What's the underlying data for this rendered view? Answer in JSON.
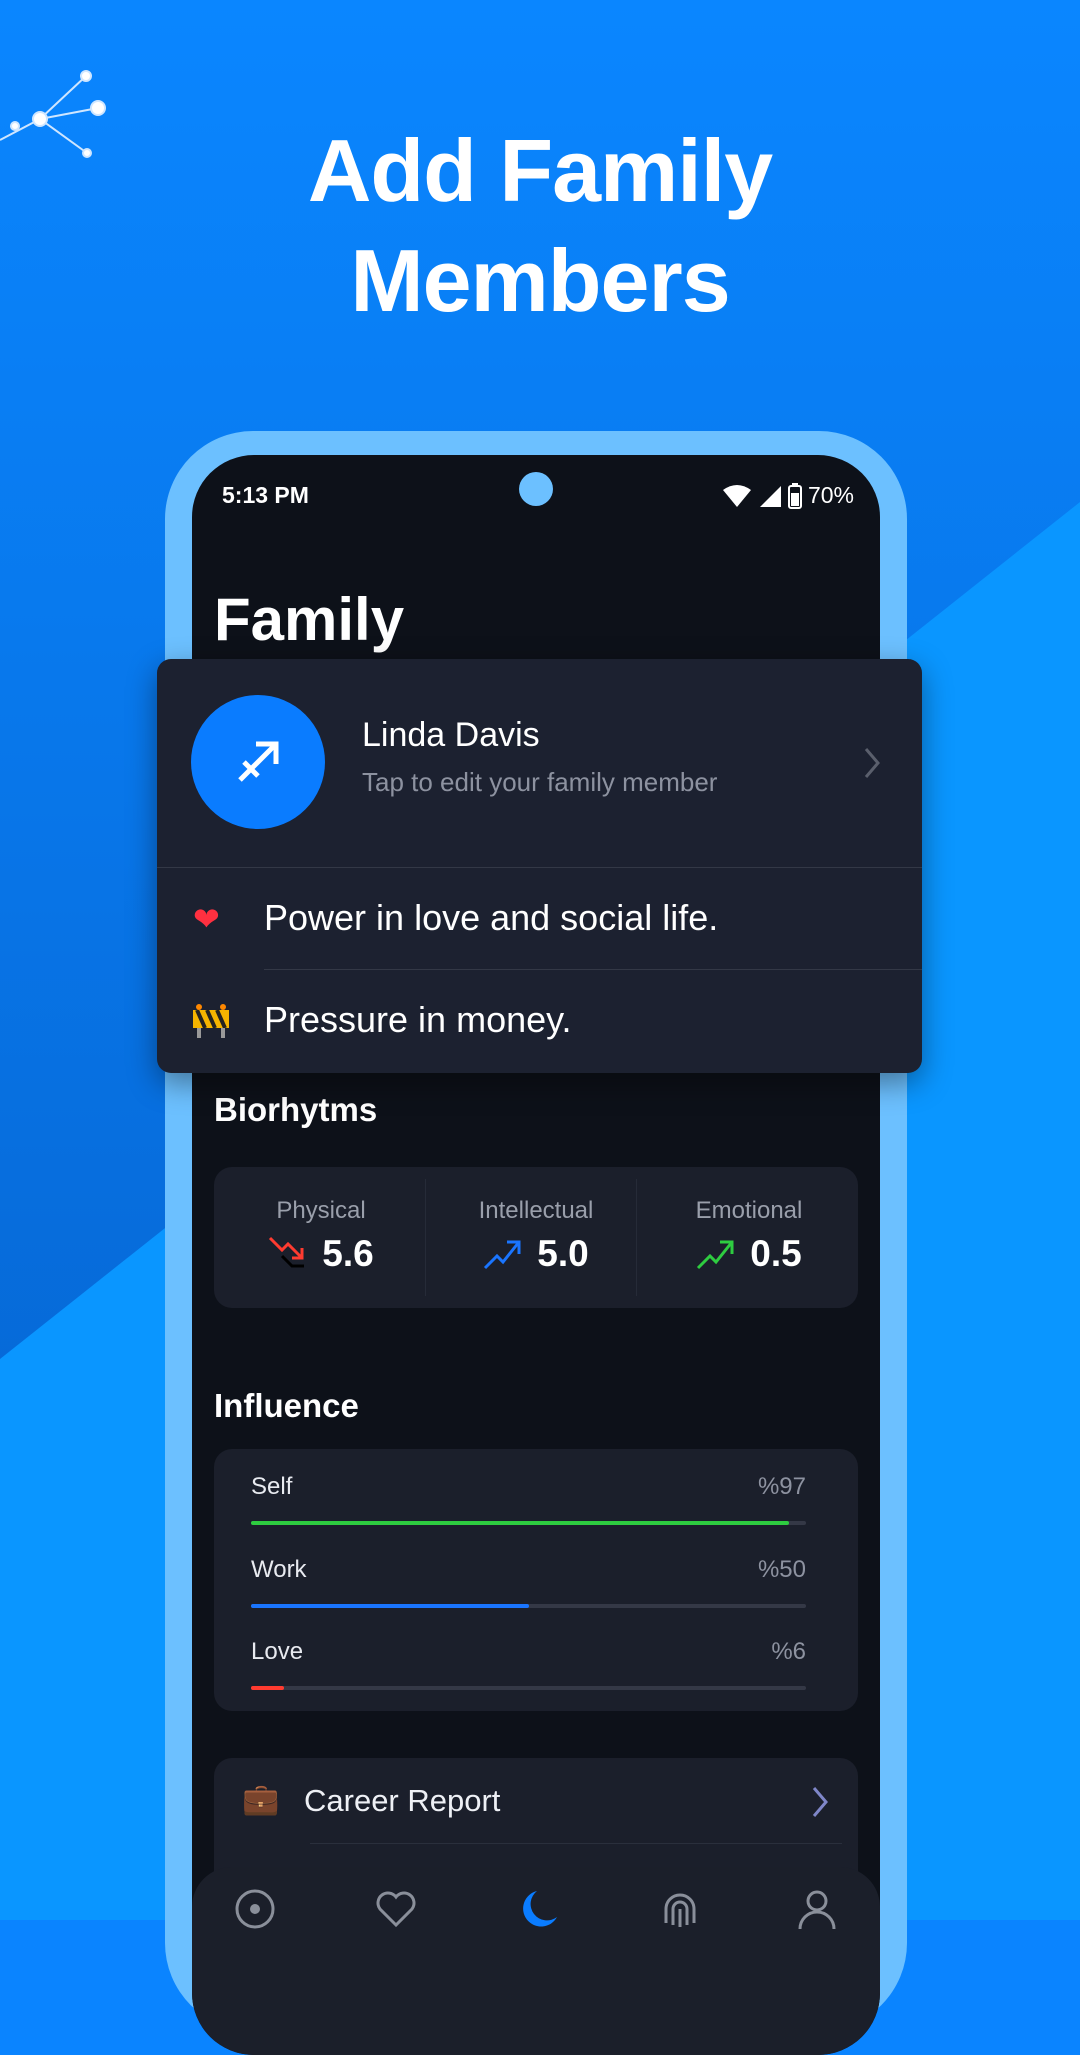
{
  "headline": {
    "line1": "Add Family",
    "line2": "Members"
  },
  "colors": {
    "background": "#0a84ff",
    "frame": "#6cc0ff",
    "accent": "#0a7cff",
    "green": "#2ecc40",
    "blue": "#1a75ff",
    "red": "#ff3b30"
  },
  "status_bar": {
    "time": "5:13 PM",
    "battery": "70%"
  },
  "page_title": "Family",
  "member_card": {
    "name": "Linda Davis",
    "subtitle": "Tap to edit your family member",
    "avatar_icon": "sagittarius-icon",
    "highlights": [
      {
        "icon": "heart-emoji",
        "text": "Power in love and social life."
      },
      {
        "icon": "construction-emoji",
        "text": "Pressure in money."
      }
    ]
  },
  "biorhythms": {
    "title": "Biorhytms",
    "items": [
      {
        "label": "Physical",
        "value": "5.6",
        "trend": "down"
      },
      {
        "label": "Intellectual",
        "value": "5.0",
        "trend": "up"
      },
      {
        "label": "Emotional",
        "value": "0.5",
        "trend": "up"
      }
    ]
  },
  "influence": {
    "title": "Influence",
    "items": [
      {
        "label": "Self",
        "value_text": "%97",
        "percent": 97,
        "color": "#2ecc40"
      },
      {
        "label": "Work",
        "value_text": "%50",
        "percent": 50,
        "color": "#1a75ff"
      },
      {
        "label": "Love",
        "value_text": "%6",
        "percent": 6,
        "color": "#ff3b30"
      }
    ]
  },
  "reports": [
    {
      "icon": "briefcase-icon",
      "label": "Career Report"
    }
  ],
  "bottom_nav": [
    "horoscope-icon",
    "heart-icon",
    "moon-icon",
    "fingerprint-icon",
    "profile-icon"
  ]
}
